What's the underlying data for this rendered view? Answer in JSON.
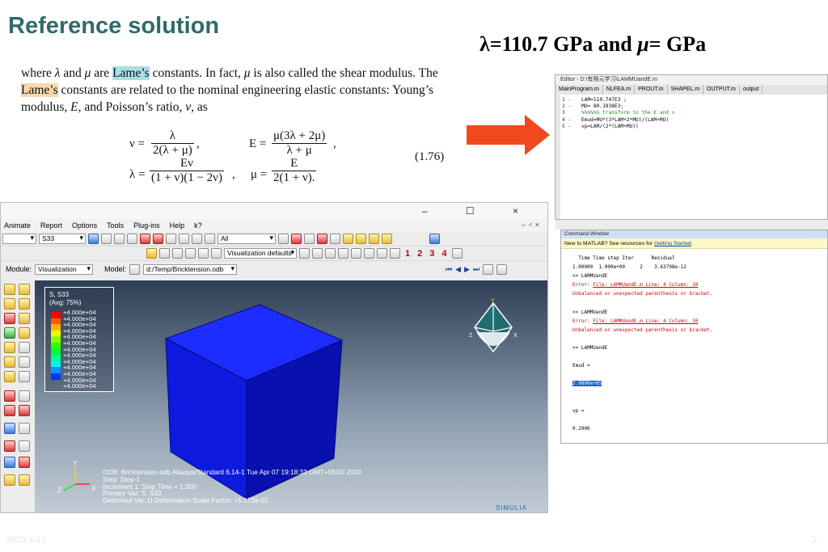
{
  "slide": {
    "title": "Reference solution",
    "params": {
      "p1": "λ=110.7 GPa and ",
      "mu": "μ",
      "p2": "=  GPa"
    },
    "date": "2025/4/23",
    "page": "5"
  },
  "textbook": {
    "s1": "where ",
    "lam": "λ",
    "s2": " and ",
    "mu": "μ",
    "s3": " are ",
    "lames1": "Lame’s",
    "s4": " constants. In fact, ",
    "s5": " is also called the shear modulus. The ",
    "lames2": "Lame’s",
    "s6": " constants are related to the nominal engineering elastic constants: Young’s modulus, ",
    "E": "E",
    "s7": ", and Poisson’s ratio, ",
    "nu": "ν",
    "s8": ", as",
    "eq_nu_lhs": "ν =",
    "eq_nu_num": "λ",
    "eq_nu_den": "2(λ + μ)",
    "eq_E_lhs": "E =",
    "eq_E_num": "μ(3λ + 2μ)",
    "eq_E_den": "λ + μ",
    "eq_lam_lhs": "λ =",
    "eq_lam_num": "Eν",
    "eq_lam_den": "(1 + ν)(1 − 2ν)",
    "eq_mu_lhs": "μ =",
    "eq_mu_num": "E",
    "eq_mu_den": "2(1 + ν).",
    "comma": ",",
    "eq_no": "(1.76)"
  },
  "colors": {
    "arrow": "#ee4a1e",
    "title": "#2f6b6a",
    "cube_front": "#0d1be0",
    "cube_top": "#1d2cff",
    "cube_side": "#0810b0"
  },
  "abaqus": {
    "menu": [
      "Animate",
      "Report",
      "Options",
      "Tools",
      "Plug-ins",
      "Help"
    ],
    "menu_help_icon": "k?",
    "win_buttons": "– ☐ ×",
    "menu_right": "– ♂ ×",
    "field_combo": "S33",
    "all_combo": "All",
    "viz_defaults": "Visualization defaults",
    "module_label": "Module:",
    "module_value": "Visualization",
    "model_label": "Model:",
    "model_value": "d:/Temp/Bricktension.odb",
    "viewport_numbers": [
      "1",
      "2",
      "3",
      "4"
    ],
    "legend": {
      "title": "S, S33",
      "subtitle": "(Avg: 75%)",
      "values": [
        "+4.000e+04",
        "+4.000e+04",
        "+4.000e+04",
        "+4.000e+04",
        "+4.000e+04",
        "+4.000e+04",
        "+4.000e+04",
        "+4.000e+04",
        "+4.000e+04",
        "+4.000e+04",
        "+4.000e+04",
        "+4.000e+04",
        "+4.000e+04"
      ],
      "colors": [
        "#ff0000",
        "#ff5a00",
        "#ffb400",
        "#e6ff00",
        "#8cff00",
        "#2cff00",
        "#00ff3a",
        "#00ff9a",
        "#00f5ff",
        "#0096ff",
        "#0038ff"
      ]
    },
    "info": {
      "odb": "ODB: Bricktension.odb    Abaqus/Standard 6.14-1    Tue Apr 07 19:18:33 GMT+08:00 2020",
      "step": "Step: Step-1",
      "increment": "Increment      1: Step Time =    1.000",
      "primary": "Primary Var: S, S33",
      "deformed": "Deformed Var: U   Deformation Scale Factor: +5.173e-01"
    },
    "triad": {
      "x": "X",
      "y": "Y",
      "z": "Z"
    },
    "brand": "SIMULIA"
  },
  "matlab": {
    "editor_title": "Editor - D:\\有限元学习\\LAMMUandE.m",
    "tabs": [
      "MainProgram.m",
      "NLFEA.m",
      "PROUT.m",
      "SHAPEL.m",
      "OUTPUT.m",
      "output"
    ],
    "code": [
      {
        "ln": "1 -",
        "text": "LAM=110.747E3 ;"
      },
      {
        "ln": "2 -",
        "text": "MU= 80.1938E3;"
      },
      {
        "ln": "3",
        "text": "%%%%%% transform to the E and ν",
        "comment": true
      },
      {
        "ln": "4 -",
        "text": "Emud=MU*(3*LAM+2*MU)/(LAM+MU)"
      },
      {
        "ln": "5 -",
        "text": "vp=LAM/(2*(LAM+MU))"
      }
    ],
    "cmd_title": "Command Window",
    "cmd_notice": "New to MATLAB? See resources for ",
    "cmd_notice_link": "Getting Started",
    "cmd_notice_end": ".",
    "cmd": {
      "hdr": "  Time Time step Iter      Residual",
      "row": "1.00000  1.000e+00     2    3.63798e-12",
      "run1": ">> LAMMUandE",
      "err1": "Error: ",
      "errloc1": "File: LAMMUandE.m Line: 4 Column: 30",
      "msg1": "Unbalanced or unexpected parenthesis or bracket.",
      "run2": ">> LAMMUandE",
      "errloc2": "File: LAMMUandE.m Line: 4 Column: 30",
      "msg2": "Unbalanced or unexpected parenthesis or bracket.",
      "run3": ">> LAMMUandE",
      "emud": "Emud =",
      "emud_val": "2.0890e+05",
      "vp": "vp =",
      "vp_val": "0.2900"
    }
  }
}
